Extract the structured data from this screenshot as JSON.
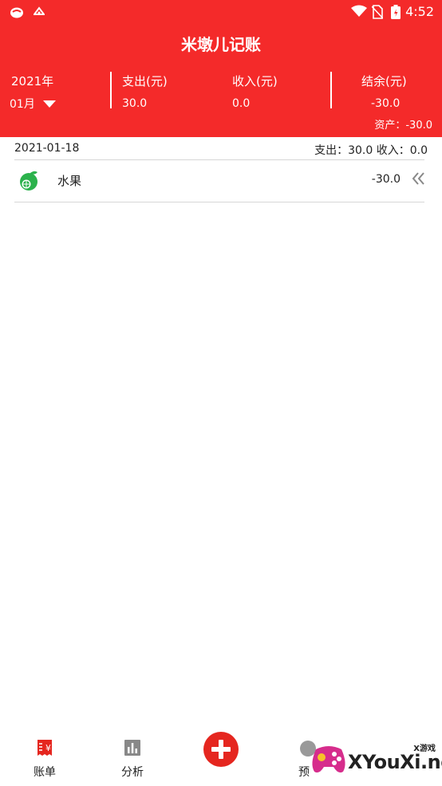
{
  "status_bar": {
    "time": "4:52"
  },
  "header": {
    "title": "米墩儿记账",
    "year": "2021年",
    "month": "01月",
    "expense_label": "支出(元)",
    "expense_value": "30.0",
    "income_label": "收入(元)",
    "income_value": "0.0",
    "balance_label": "结余(元)",
    "balance_value": "-30.0",
    "assets": "资产：-30.0"
  },
  "day_group": {
    "date": "2021-01-18",
    "summary": "支出：30.0 收入：0.0"
  },
  "entries": [
    {
      "label": "水果",
      "amount": "-30.0",
      "icon": "fruit-icon"
    }
  ],
  "tabbar": {
    "bills": "账单",
    "analysis": "分析",
    "budget_partial": "预"
  },
  "watermark": {
    "text": "XYouXi.net",
    "small": "X游戏"
  },
  "colors": {
    "brand": "#f42a2a",
    "fruit": "#2bb24c"
  }
}
